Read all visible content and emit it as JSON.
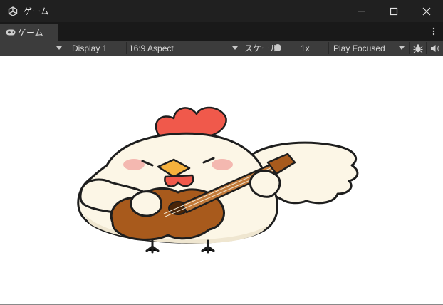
{
  "window": {
    "title": "ゲーム",
    "icon": "unity-logo-icon",
    "controls": [
      "minimize-icon",
      "maximize-icon",
      "close-icon"
    ]
  },
  "tab": {
    "label": "ゲーム",
    "icon": "gamepad-icon"
  },
  "toolbar": {
    "display": "Display 1",
    "aspect": "16:9 Aspect",
    "scale_label": "スケール",
    "scale_value": "1x",
    "play_mode": "Play Focused",
    "bug_icon": "bug-icon",
    "audio_icon": "speaker-icon"
  },
  "viewport": {
    "image": "cartoon chicken playing guitar"
  },
  "colors": {
    "accent": "#3d8edb",
    "toolbar_bg": "#3c3c3c",
    "title_bg": "#202020",
    "comb": "#f0594b",
    "beak": "#f5b13c",
    "guitar": "#a85a1c",
    "body": "#fcf6e6"
  }
}
